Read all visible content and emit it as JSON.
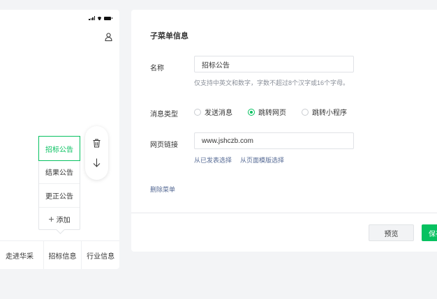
{
  "preview": {
    "submenu_items": [
      "招标公告",
      "结果公告",
      "更正公告"
    ],
    "submenu_add_label": "添加",
    "menu_bar": [
      "走进华采",
      "招标信息",
      "行业信息"
    ]
  },
  "form": {
    "title": "子菜单信息",
    "name_label": "名称",
    "name_value": "招标公告",
    "name_hint": "仅支持中英文和数字，字数不超过8个汉字或16个字母。",
    "type_label": "消息类型",
    "type_options": [
      "发送消息",
      "跳转网页",
      "跳转小程序"
    ],
    "type_selected": "跳转网页",
    "url_label": "网页链接",
    "url_value": "www.jshczb.com",
    "link_published": "从已发表选择",
    "link_template": "从页面模版选择",
    "delete_label": "删除菜单",
    "preview_button": "预览",
    "save_button": "保存"
  },
  "colors": {
    "accent": "#07c160",
    "link": "#576b95"
  }
}
